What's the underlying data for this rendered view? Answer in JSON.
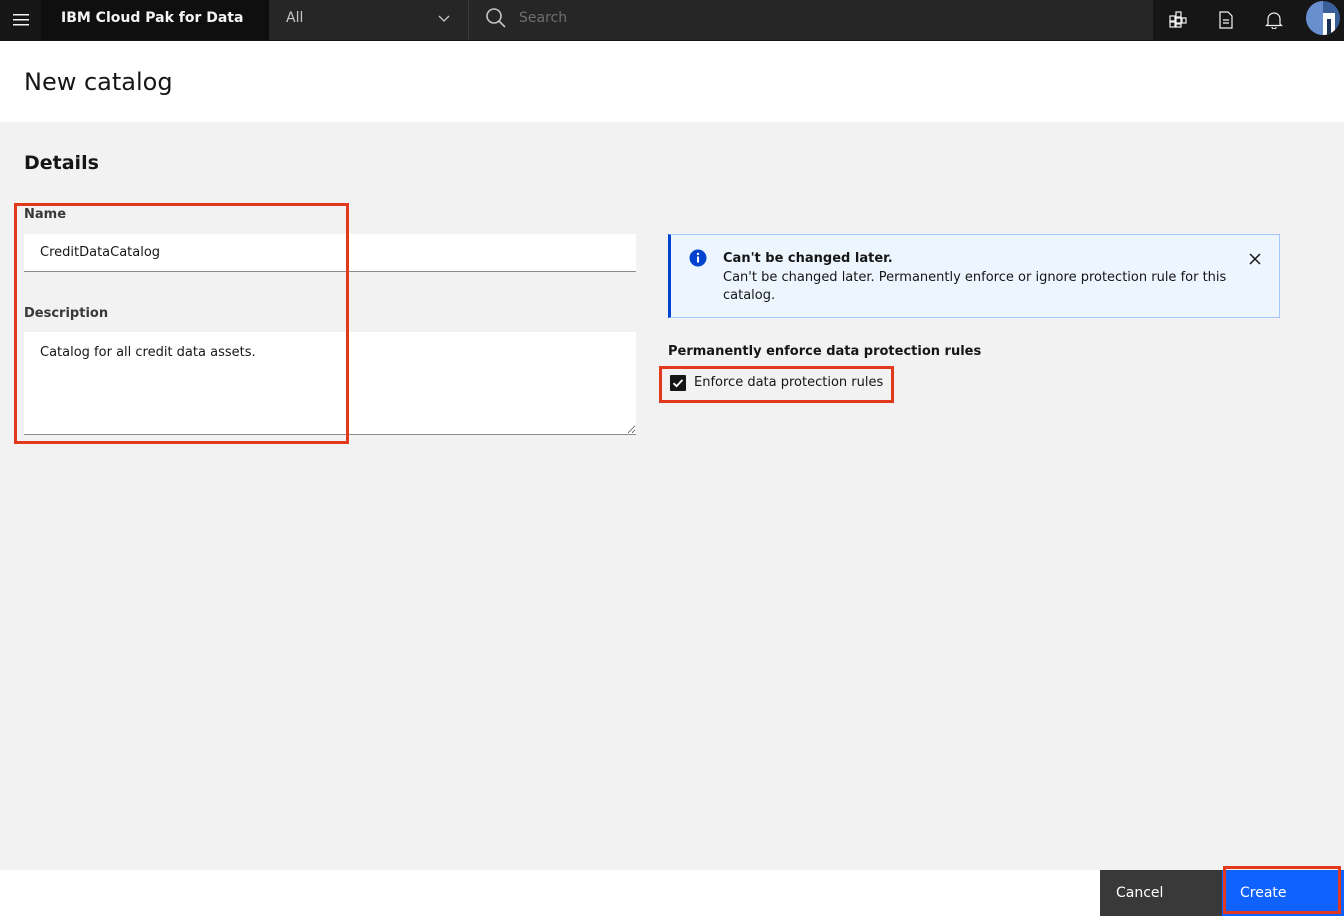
{
  "header": {
    "menu_icon": "hamburger-menu-icon",
    "brand": "IBM Cloud Pak for Data",
    "scope_selected": "All",
    "search_placeholder": "Search",
    "icons": [
      "services-grid-icon",
      "document-icon",
      "notification-bell-icon"
    ],
    "avatar": "user-avatar"
  },
  "page": {
    "title": "New catalog"
  },
  "details": {
    "section_title": "Details",
    "name_label": "Name",
    "name_value": "CreditDataCatalog",
    "description_label": "Description",
    "description_value": "Catalog for all credit data assets."
  },
  "notice": {
    "icon": "info-icon",
    "title": "Can't be changed later.",
    "body": "Can't be changed later. Permanently enforce or ignore protection rule for this catalog.",
    "close_icon": "close-icon"
  },
  "protection": {
    "heading": "Permanently enforce data protection rules",
    "checkbox_label": "Enforce data protection rules",
    "checked": true
  },
  "footer": {
    "cancel_label": "Cancel",
    "create_label": "Create"
  },
  "colors": {
    "highlight": "#e0391e",
    "primary": "#0f62fe",
    "header_bg": "#161616",
    "notice_bg": "#edf5ff"
  }
}
